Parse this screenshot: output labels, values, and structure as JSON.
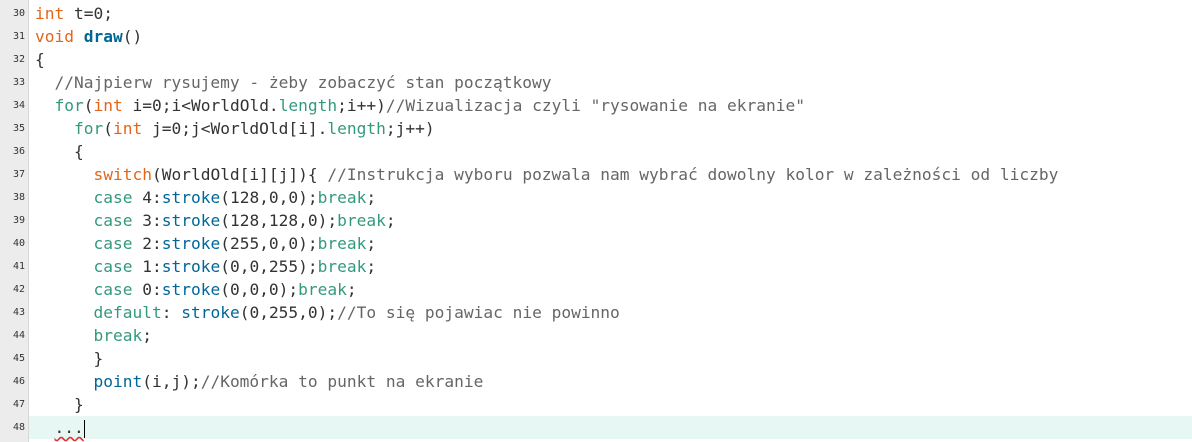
{
  "line_numbers": [
    "30",
    "31",
    "32",
    "33",
    "34",
    "35",
    "36",
    "37",
    "38",
    "39",
    "40",
    "41",
    "42",
    "43",
    "44",
    "45",
    "46",
    "47",
    "48"
  ],
  "lines": [
    [
      {
        "t": "int",
        "c": "kw"
      },
      {
        "t": " t=0;",
        "c": "tx"
      }
    ],
    [
      {
        "t": "void",
        "c": "kw"
      },
      {
        "t": " ",
        "c": "tx"
      },
      {
        "t": "draw",
        "c": "fnb"
      },
      {
        "t": "()",
        "c": "tx"
      }
    ],
    [
      {
        "t": "{",
        "c": "tx"
      }
    ],
    [
      {
        "t": "  ",
        "c": "tx"
      },
      {
        "t": "//Najpierw rysujemy - żeby zobaczyć stan początkowy",
        "c": "cm"
      }
    ],
    [
      {
        "t": "  ",
        "c": "tx"
      },
      {
        "t": "for",
        "c": "kw2"
      },
      {
        "t": "(",
        "c": "tx"
      },
      {
        "t": "int",
        "c": "kw"
      },
      {
        "t": " i=0;i<WorldOld.",
        "c": "tx"
      },
      {
        "t": "length",
        "c": "kw2"
      },
      {
        "t": ";i++)",
        "c": "tx"
      },
      {
        "t": "//Wizualizacja czyli \"rysowanie na ekranie\"",
        "c": "cm"
      }
    ],
    [
      {
        "t": "    ",
        "c": "tx"
      },
      {
        "t": "for",
        "c": "kw2"
      },
      {
        "t": "(",
        "c": "tx"
      },
      {
        "t": "int",
        "c": "kw"
      },
      {
        "t": " j=0;j<WorldOld[i].",
        "c": "tx"
      },
      {
        "t": "length",
        "c": "kw2"
      },
      {
        "t": ";j++)",
        "c": "tx"
      }
    ],
    [
      {
        "t": "    {",
        "c": "tx"
      }
    ],
    [
      {
        "t": "      ",
        "c": "tx"
      },
      {
        "t": "switch",
        "c": "kw"
      },
      {
        "t": "(WorldOld[i][j]){ ",
        "c": "tx"
      },
      {
        "t": "//Instrukcja wyboru pozwala nam wybrać dowolny kolor w zależności od liczby",
        "c": "cm"
      }
    ],
    [
      {
        "t": "      ",
        "c": "tx"
      },
      {
        "t": "case",
        "c": "kw2"
      },
      {
        "t": " 4:",
        "c": "tx"
      },
      {
        "t": "stroke",
        "c": "fn"
      },
      {
        "t": "(128,0,0);",
        "c": "tx"
      },
      {
        "t": "break",
        "c": "kw2"
      },
      {
        "t": ";",
        "c": "tx"
      }
    ],
    [
      {
        "t": "      ",
        "c": "tx"
      },
      {
        "t": "case",
        "c": "kw2"
      },
      {
        "t": " 3:",
        "c": "tx"
      },
      {
        "t": "stroke",
        "c": "fn"
      },
      {
        "t": "(128,128,0);",
        "c": "tx"
      },
      {
        "t": "break",
        "c": "kw2"
      },
      {
        "t": ";",
        "c": "tx"
      }
    ],
    [
      {
        "t": "      ",
        "c": "tx"
      },
      {
        "t": "case",
        "c": "kw2"
      },
      {
        "t": " 2:",
        "c": "tx"
      },
      {
        "t": "stroke",
        "c": "fn"
      },
      {
        "t": "(255,0,0);",
        "c": "tx"
      },
      {
        "t": "break",
        "c": "kw2"
      },
      {
        "t": ";",
        "c": "tx"
      }
    ],
    [
      {
        "t": "      ",
        "c": "tx"
      },
      {
        "t": "case",
        "c": "kw2"
      },
      {
        "t": " 1:",
        "c": "tx"
      },
      {
        "t": "stroke",
        "c": "fn"
      },
      {
        "t": "(0,0,255);",
        "c": "tx"
      },
      {
        "t": "break",
        "c": "kw2"
      },
      {
        "t": ";",
        "c": "tx"
      }
    ],
    [
      {
        "t": "      ",
        "c": "tx"
      },
      {
        "t": "case",
        "c": "kw2"
      },
      {
        "t": " 0:",
        "c": "tx"
      },
      {
        "t": "stroke",
        "c": "fn"
      },
      {
        "t": "(0,0,0);",
        "c": "tx"
      },
      {
        "t": "break",
        "c": "kw2"
      },
      {
        "t": ";",
        "c": "tx"
      }
    ],
    [
      {
        "t": "      ",
        "c": "tx"
      },
      {
        "t": "default",
        "c": "kw2"
      },
      {
        "t": ": ",
        "c": "tx"
      },
      {
        "t": "stroke",
        "c": "fn"
      },
      {
        "t": "(0,255,0);",
        "c": "tx"
      },
      {
        "t": "//To się pojawiac nie powinno",
        "c": "cm"
      }
    ],
    [
      {
        "t": "      ",
        "c": "tx"
      },
      {
        "t": "break",
        "c": "kw2"
      },
      {
        "t": ";",
        "c": "tx"
      }
    ],
    [
      {
        "t": "      }",
        "c": "tx"
      }
    ],
    [
      {
        "t": "      ",
        "c": "tx"
      },
      {
        "t": "point",
        "c": "fn"
      },
      {
        "t": "(i,j);",
        "c": "tx"
      },
      {
        "t": "//Komórka to punkt na ekranie",
        "c": "cm"
      }
    ],
    [
      {
        "t": "    }",
        "c": "tx"
      }
    ],
    [
      {
        "t": "  ",
        "c": "tx"
      },
      {
        "t": "...",
        "c": "tx squiggle"
      }
    ]
  ],
  "current_line_index": 18
}
